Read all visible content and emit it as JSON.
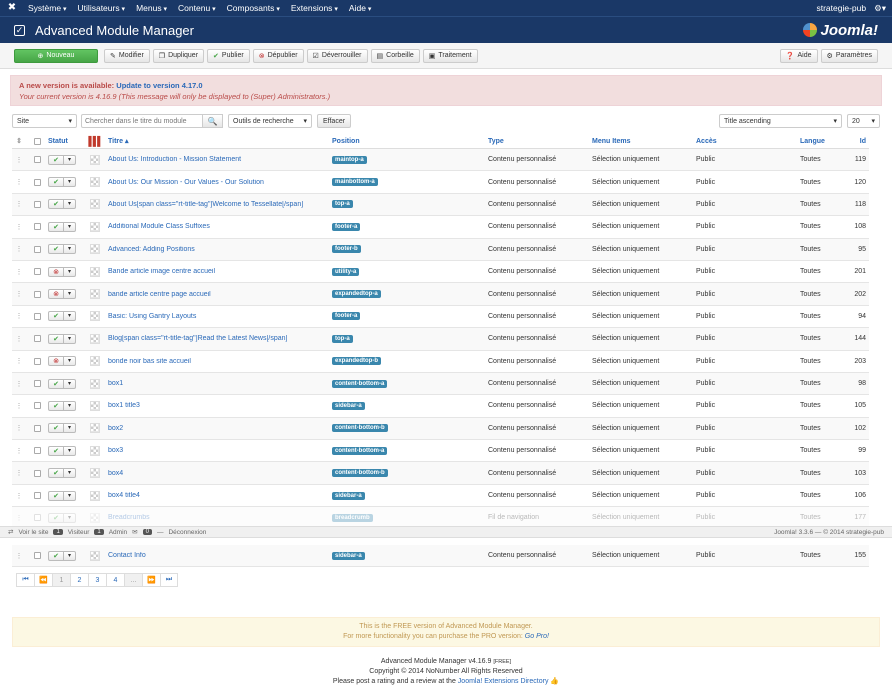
{
  "topbar": {
    "menu": [
      "Système",
      "Utilisateurs",
      "Menus",
      "Contenu",
      "Composants",
      "Extensions",
      "Aide"
    ],
    "user": "strategie-pub"
  },
  "title": "Advanced Module Manager",
  "brand": "Joomla!",
  "toolbar": {
    "new": "Nouveau",
    "edit": "Modifier",
    "duplicate": "Dupliquer",
    "publish": "Publier",
    "unpublish": "Dépublier",
    "unlock": "Déverrouiller",
    "trash": "Corbeille",
    "batch": "Traitement",
    "help": "Aide",
    "options": "Paramètres"
  },
  "alert": {
    "line1_prefix": "A new version is available:",
    "line1_link": "Update to version 4.17.0",
    "line2": "Your current version is 4.16.9 (This message will only be displayed to (Super) Administrators.)"
  },
  "filters": {
    "client": "Site",
    "search_placeholder": "Chercher dans le titre du module",
    "tools": "Outils de recherche",
    "clear": "Effacer",
    "sort": "Title ascending",
    "limit": "20"
  },
  "columns": {
    "status": "Statut",
    "title": "Titre",
    "position": "Position",
    "type": "Type",
    "menu": "Menu Items",
    "access": "Accès",
    "language": "Langue",
    "id": "Id"
  },
  "rows": [
    {
      "title": "About Us: Introduction - Mission Statement",
      "position": "maintop-a",
      "type": "Contenu personnalisé",
      "menu": "Sélection uniquement",
      "access": "Public",
      "language": "Toutes",
      "id": "119",
      "published": true
    },
    {
      "title": "About Us: Our Mission - Our Values - Our Solution",
      "position": "mainbottom-a",
      "type": "Contenu personnalisé",
      "menu": "Sélection uniquement",
      "access": "Public",
      "language": "Toutes",
      "id": "120",
      "published": true
    },
    {
      "title": "About Us[span class=\"rt-title-tag\"]Welcome to Tessellate[/span]",
      "position": "top-a",
      "type": "Contenu personnalisé",
      "menu": "Sélection uniquement",
      "access": "Public",
      "language": "Toutes",
      "id": "118",
      "published": true
    },
    {
      "title": "Additional Module Class Suffixes",
      "position": "footer-a",
      "type": "Contenu personnalisé",
      "menu": "Sélection uniquement",
      "access": "Public",
      "language": "Toutes",
      "id": "108",
      "published": true
    },
    {
      "title": "Advanced: Adding Positions",
      "position": "footer-b",
      "type": "Contenu personnalisé",
      "menu": "Sélection uniquement",
      "access": "Public",
      "language": "Toutes",
      "id": "95",
      "published": true
    },
    {
      "title": "Bande article image centre accueil",
      "position": "utility-a",
      "type": "Contenu personnalisé",
      "menu": "Sélection uniquement",
      "access": "Public",
      "language": "Toutes",
      "id": "201",
      "published": false
    },
    {
      "title": "bande article centre page accueil",
      "position": "expandedtop-a",
      "type": "Contenu personnalisé",
      "menu": "Sélection uniquement",
      "access": "Public",
      "language": "Toutes",
      "id": "202",
      "published": false
    },
    {
      "title": "Basic: Using Gantry Layouts",
      "position": "footer-a",
      "type": "Contenu personnalisé",
      "menu": "Sélection uniquement",
      "access": "Public",
      "language": "Toutes",
      "id": "94",
      "published": true
    },
    {
      "title": "Blog[span class=\"rt-title-tag\"]Read the Latest News[/span]",
      "position": "top-a",
      "type": "Contenu personnalisé",
      "menu": "Sélection uniquement",
      "access": "Public",
      "language": "Toutes",
      "id": "144",
      "published": true
    },
    {
      "title": "bonde noir bas site accueil",
      "position": "expandedtop-b",
      "type": "Contenu personnalisé",
      "menu": "Sélection uniquement",
      "access": "Public",
      "language": "Toutes",
      "id": "203",
      "published": false
    },
    {
      "title": "box1",
      "position": "content-bottom-a",
      "type": "Contenu personnalisé",
      "menu": "Sélection uniquement",
      "access": "Public",
      "language": "Toutes",
      "id": "98",
      "published": true
    },
    {
      "title": "box1 title3",
      "position": "sidebar-a",
      "type": "Contenu personnalisé",
      "menu": "Sélection uniquement",
      "access": "Public",
      "language": "Toutes",
      "id": "105",
      "published": true
    },
    {
      "title": "box2",
      "position": "content-bottom-b",
      "type": "Contenu personnalisé",
      "menu": "Sélection uniquement",
      "access": "Public",
      "language": "Toutes",
      "id": "102",
      "published": true
    },
    {
      "title": "box3",
      "position": "content-bottom-a",
      "type": "Contenu personnalisé",
      "menu": "Sélection uniquement",
      "access": "Public",
      "language": "Toutes",
      "id": "99",
      "published": true
    },
    {
      "title": "box4",
      "position": "content-bottom-b",
      "type": "Contenu personnalisé",
      "menu": "Sélection uniquement",
      "access": "Public",
      "language": "Toutes",
      "id": "103",
      "published": true
    },
    {
      "title": "box4 title4",
      "position": "sidebar-a",
      "type": "Contenu personnalisé",
      "menu": "Sélection uniquement",
      "access": "Public",
      "language": "Toutes",
      "id": "106",
      "published": true
    },
    {
      "title": "Breadcrumbs",
      "position": "breadcrumb",
      "type": "Fil de navigation",
      "menu": "Sélection uniquement",
      "access": "Public",
      "language": "Toutes",
      "id": "177",
      "published": true
    }
  ],
  "lastrow": {
    "title": "Contact Info",
    "position": "sidebar-a",
    "type": "Contenu personnalisé",
    "menu": "Sélection uniquement",
    "access": "Public",
    "language": "Toutes",
    "id": "155",
    "published": true
  },
  "statusbar": {
    "view_site": "Voir le site",
    "visitors_count": "1",
    "visitors": "Visiteur",
    "admin_count": "1",
    "admin": "Admin",
    "messages_count": "0",
    "logout": "Déconnexion",
    "version": "Joomla! 3.3.6 — © 2014 strategie-pub"
  },
  "pagination": [
    "1",
    "2",
    "3",
    "4",
    "..."
  ],
  "freebox": {
    "line1": "This is the FREE version of Advanced Module Manager.",
    "line2_prefix": "For more functionality you can purchase the PRO version:",
    "line2_link": "Go Pro!"
  },
  "footer": {
    "line1": "Advanced Module Manager v4.16.9",
    "free": "[FREE]",
    "line2": "Copyright © 2014 NoNumber All Rights Reserved",
    "line3_prefix": "Please post a rating and a review at the",
    "line3_link": "Joomla! Extensions Directory"
  },
  "colors": {
    "navy": "#1a3867",
    "link": "#2a69b8",
    "badge": "#3a87ad",
    "green": "#46a546"
  }
}
